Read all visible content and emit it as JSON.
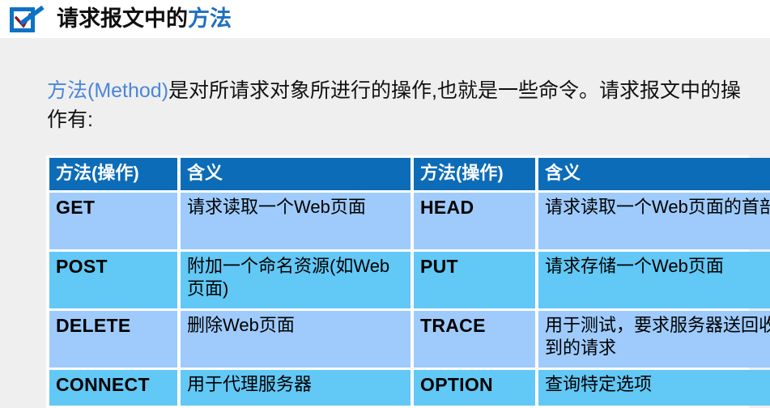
{
  "slide": {
    "title_prefix": "请求报文中的",
    "title_accent": "方法",
    "title_icon": "checkbox-check-icon",
    "background_color": "#efefef",
    "title_band_color": "#ffffff"
  },
  "intro": {
    "accent_text": "方法(Method)",
    "rest_text": "是对所请求对象所进行的操作,也就是一些命令。请求报文中的操作有:"
  },
  "table": {
    "header_color": "#0c6cb8",
    "row_color_light": "#9ecbfb",
    "row_color_dark": "#62c8f5",
    "headers": [
      "方法(操作)",
      "含义",
      "方法(操作)",
      "含义"
    ],
    "rows": [
      {
        "style": "light",
        "left_method": "GET",
        "left_meaning": "请求读取一个Web页面",
        "right_method": "HEAD",
        "right_meaning": "请求读取一个Web页面的首部"
      },
      {
        "style": "dark",
        "left_method": "POST",
        "left_meaning": "附加一个命名资源(如Web页面)",
        "right_method": "PUT",
        "right_meaning": "请求存储一个Web页面"
      },
      {
        "style": "light",
        "left_method": "DELETE",
        "left_meaning": "删除Web页面",
        "right_method": "TRACE",
        "right_meaning": "用于测试，要求服务器送回收到的请求"
      },
      {
        "style": "dark",
        "left_method": "CONNECT",
        "left_meaning": "用于代理服务器",
        "right_method": "OPTION",
        "right_meaning": "查询特定选项"
      }
    ]
  }
}
